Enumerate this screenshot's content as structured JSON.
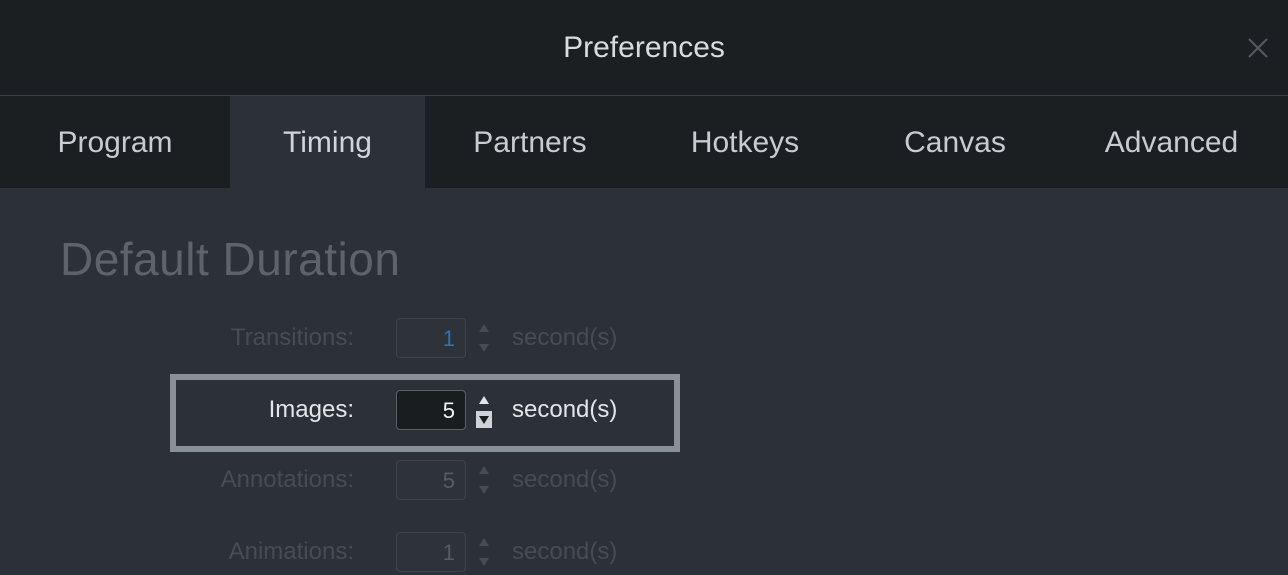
{
  "window": {
    "title": "Preferences",
    "close_icon": "close-icon"
  },
  "tabs": [
    {
      "label": "Program",
      "active": false
    },
    {
      "label": "Timing",
      "active": true
    },
    {
      "label": "Partners",
      "active": false
    },
    {
      "label": "Hotkeys",
      "active": false
    },
    {
      "label": "Canvas",
      "active": false
    },
    {
      "label": "Advanced",
      "active": false
    }
  ],
  "section": {
    "title": "Default Duration"
  },
  "durations": [
    {
      "label": "Transitions:",
      "value": "1",
      "unit": "second(s)",
      "state": "dimmed"
    },
    {
      "label": "Images:",
      "value": "5",
      "unit": "second(s)",
      "state": "highlighted"
    },
    {
      "label": "Annotations:",
      "value": "5",
      "unit": "second(s)",
      "state": "dimmed"
    },
    {
      "label": "Animations:",
      "value": "1",
      "unit": "second(s)",
      "state": "dimmed"
    }
  ],
  "colors": {
    "titlebar_bg": "#1c1f22",
    "content_bg": "#2c3137",
    "highlight_border": "#8a9196",
    "spinbox_active_bg": "#1a1d20",
    "transitions_value_accent": "#3a6ea5"
  }
}
